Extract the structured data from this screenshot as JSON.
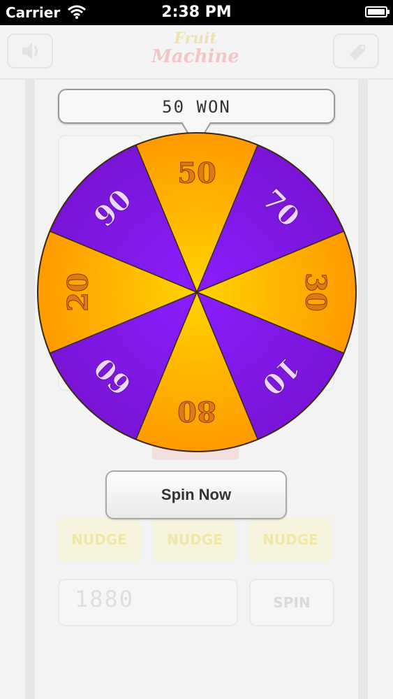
{
  "status_bar": {
    "carrier": "Carrier",
    "time": "2:38 PM"
  },
  "header": {
    "logo_line1": "Fruit",
    "logo_line2": "Machine",
    "left_icon": "speaker-icon",
    "right_icon": "tag-icon"
  },
  "result_bubble": {
    "text": "50 WON"
  },
  "wheel": {
    "segments": [
      {
        "label": "50",
        "color": "orange"
      },
      {
        "label": "70",
        "color": "purple"
      },
      {
        "label": "30",
        "color": "orange"
      },
      {
        "label": "10",
        "color": "purple"
      },
      {
        "label": "80",
        "color": "orange"
      },
      {
        "label": "60",
        "color": "purple"
      },
      {
        "label": "20",
        "color": "orange"
      },
      {
        "label": "90",
        "color": "purple"
      }
    ],
    "colors": {
      "orange_center": "#ffd400",
      "orange_edge": "#ff9a00",
      "purple_center": "#8a1dff",
      "purple_edge": "#7a14d6",
      "text_orange": "#e07a10",
      "text_purple": "#ead6ff"
    }
  },
  "spin_now_label": "Spin Now",
  "nudge_buttons": [
    "NUDGE",
    "NUDGE",
    "NUDGE"
  ],
  "credits": "1880",
  "spin_label": "SPIN"
}
